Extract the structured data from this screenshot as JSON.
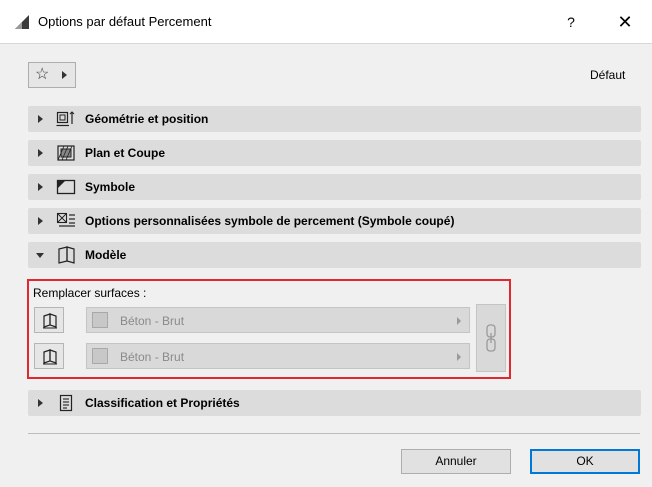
{
  "window": {
    "title": "Options par défaut Percement",
    "help_label": "?",
    "close_label": "✕"
  },
  "favorites": {
    "icon": "star-icon",
    "status_label": "Défaut"
  },
  "panels": [
    {
      "label": "Géométrie et position",
      "expanded": false,
      "icon": "geometry-icon"
    },
    {
      "label": "Plan et Coupe",
      "expanded": false,
      "icon": "floor-plan-icon"
    },
    {
      "label": "Symbole",
      "expanded": false,
      "icon": "symbol-icon"
    },
    {
      "label": "Options personnalisées symbole de percement (Symbole coupé)",
      "expanded": false,
      "icon": "custom-options-icon"
    },
    {
      "label": "Modèle",
      "expanded": true,
      "icon": "model-icon"
    },
    {
      "label": "Classification et Propriétés",
      "expanded": false,
      "icon": "classification-icon"
    }
  ],
  "model_section": {
    "override_label": "Remplacer surfaces :",
    "surfaces": [
      {
        "value": "Béton - Brut",
        "icon": "surface-side-icon"
      },
      {
        "value": "Béton - Brut",
        "icon": "surface-side-icon"
      }
    ],
    "chain_icon": "chain-link-icon"
  },
  "footer": {
    "cancel_label": "Annuler",
    "ok_label": "OK"
  }
}
